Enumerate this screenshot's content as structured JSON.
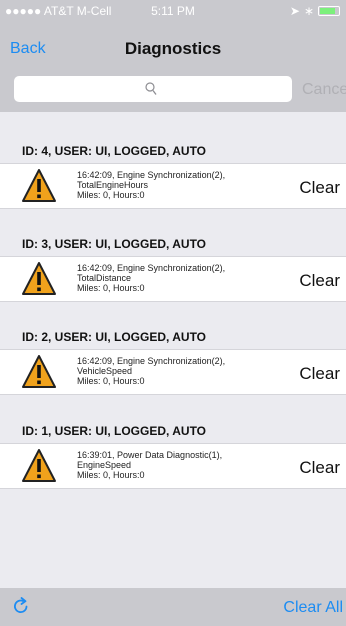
{
  "status_bar": {
    "carrier": "●●●●● AT&T M-Cell",
    "time": "5:11 PM"
  },
  "nav": {
    "back_label": "Back",
    "title": "Diagnostics"
  },
  "search": {
    "placeholder": "",
    "cancel_label": "Cance"
  },
  "entries": [
    {
      "header": "ID: 4, USER: UI, LOGGED, AUTO",
      "line1": "16:42:09, Engine Synchronization(2),",
      "line2": "TotalEngineHours",
      "line3": "Miles: 0, Hours:0",
      "action": "Clear"
    },
    {
      "header": "ID: 3, USER: UI, LOGGED, AUTO",
      "line1": "16:42:09, Engine Synchronization(2),",
      "line2": "TotalDistance",
      "line3": "Miles: 0, Hours:0",
      "action": "Clear"
    },
    {
      "header": "ID: 2, USER: UI, LOGGED, AUTO",
      "line1": "16:42:09, Engine Synchronization(2),",
      "line2": "VehicleSpeed",
      "line3": "Miles: 0, Hours:0",
      "action": "Clear"
    },
    {
      "header": "ID: 1, USER: UI, LOGGED, AUTO",
      "line1": "16:39:01, Power Data Diagnostic(1),",
      "line2": "EngineSpeed",
      "line3": "Miles: 0, Hours:0",
      "action": "Clear"
    }
  ],
  "bottom": {
    "clear_all_label": "Clear All"
  },
  "colors": {
    "accent": "#1c8cf2",
    "bar_background": "#c9c9ce",
    "warning_fill": "#f0a21c"
  }
}
